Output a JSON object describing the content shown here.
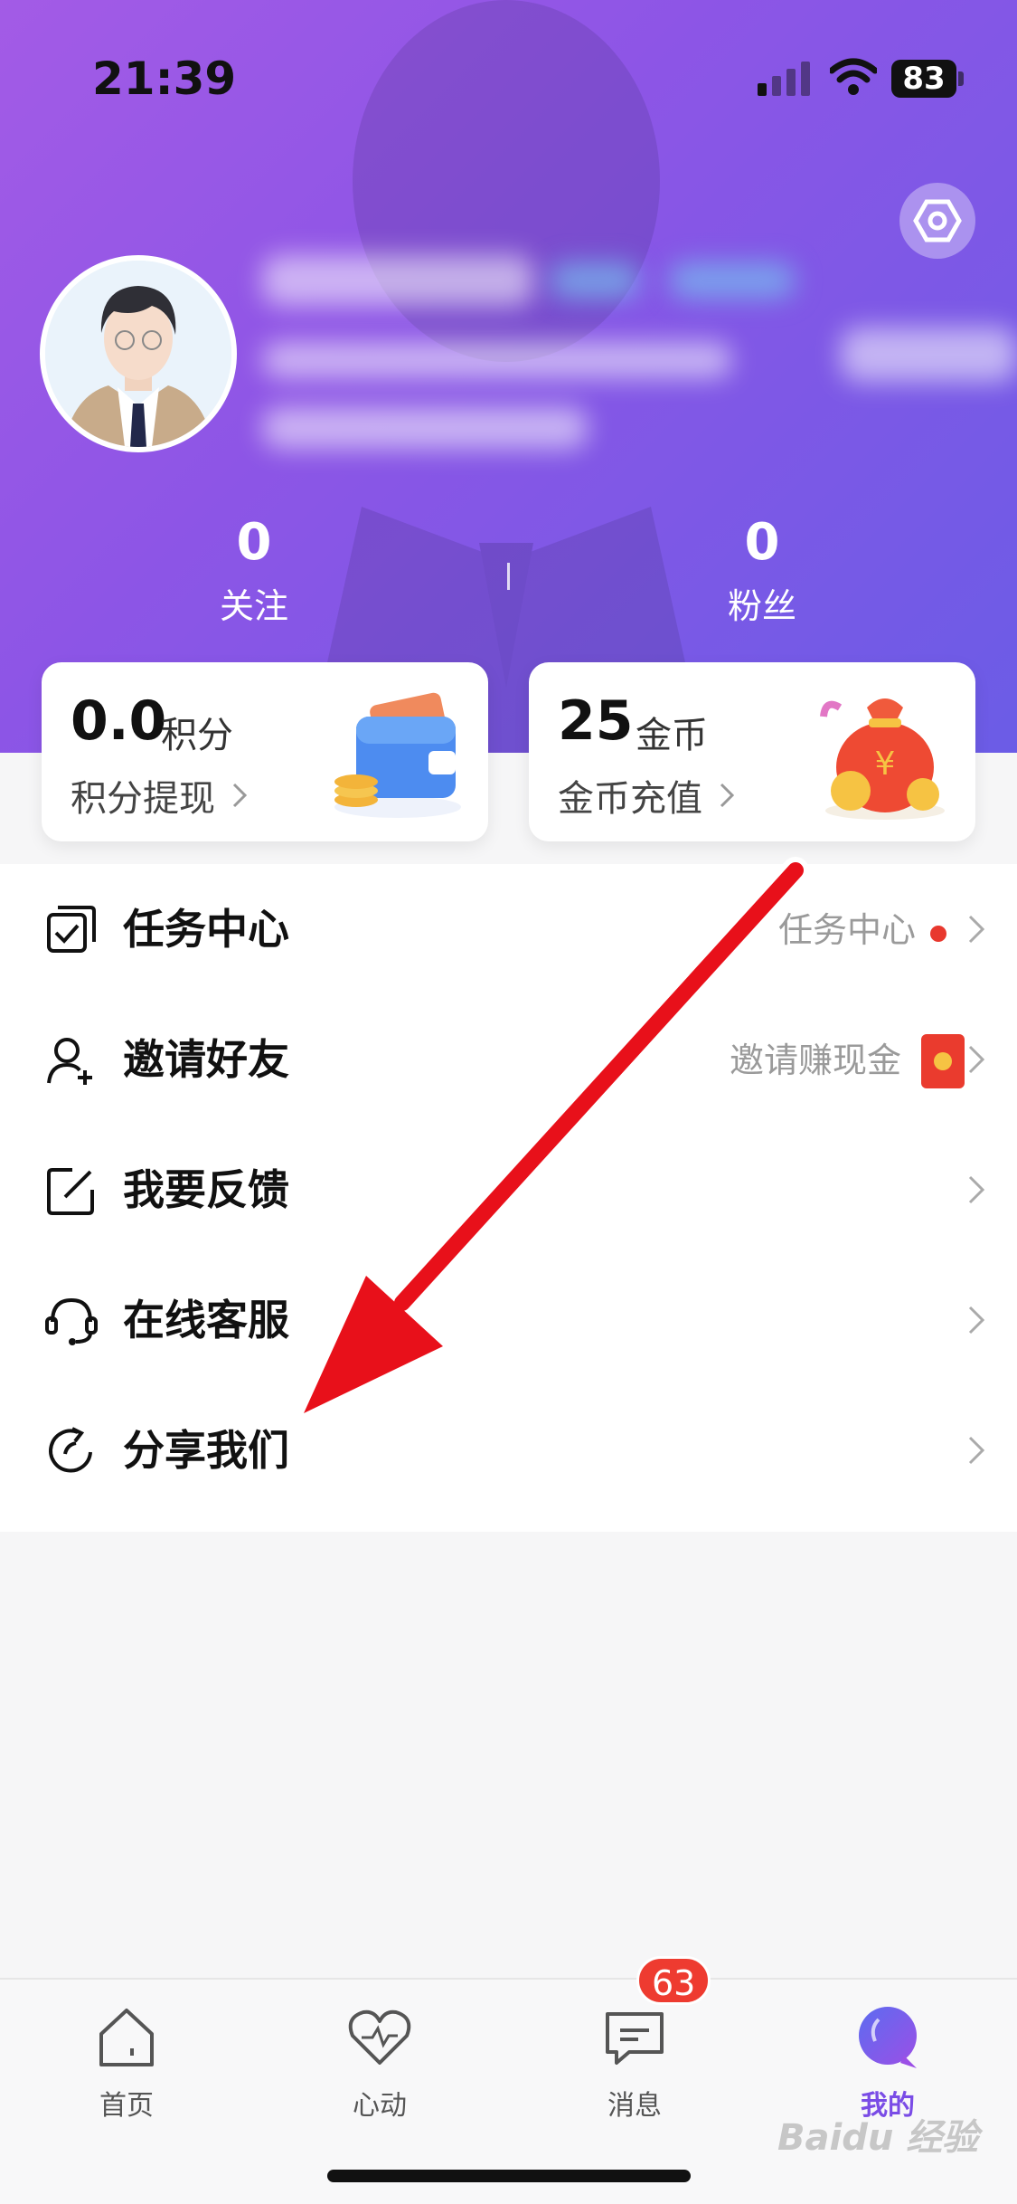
{
  "status_bar": {
    "time": "21:39",
    "battery": "83"
  },
  "profile": {
    "follow_count": "0",
    "follow_label": "关注",
    "fans_count": "0",
    "fans_label": "粉丝"
  },
  "cards": {
    "points": {
      "value": "0.0",
      "unit": "积分",
      "action": "积分提现",
      "illustration": "wallet-icon"
    },
    "coins": {
      "value": "25",
      "unit": "金币",
      "action": "金币充值",
      "illustration": "money-bag-icon"
    }
  },
  "menu": {
    "items": [
      {
        "label": "任务中心",
        "right_text": "任务中心",
        "icon": "task-check-icon",
        "extra": "red-dot"
      },
      {
        "label": "邀请好友",
        "right_text": "邀请赚现金",
        "icon": "add-user-icon",
        "extra": "red-packet"
      },
      {
        "label": "我要反馈",
        "right_text": "",
        "icon": "edit-icon",
        "extra": ""
      },
      {
        "label": "在线客服",
        "right_text": "",
        "icon": "headset-icon",
        "extra": ""
      },
      {
        "label": "分享我们",
        "right_text": "",
        "icon": "share-icon",
        "extra": ""
      }
    ]
  },
  "tabbar": {
    "tabs": [
      {
        "label": "首页",
        "icon": "home-icon"
      },
      {
        "label": "心动",
        "icon": "heart-icon"
      },
      {
        "label": "消息",
        "icon": "message-icon",
        "badge": "63"
      },
      {
        "label": "我的",
        "icon": "me-icon",
        "active": true
      }
    ]
  },
  "colors": {
    "accent": "#7a4ce6",
    "badge": "#ee3b30",
    "header_start": "#a35be6",
    "header_end": "#6b5ce6",
    "arrow": "#e8101a"
  },
  "watermark": "Baidu 经验"
}
